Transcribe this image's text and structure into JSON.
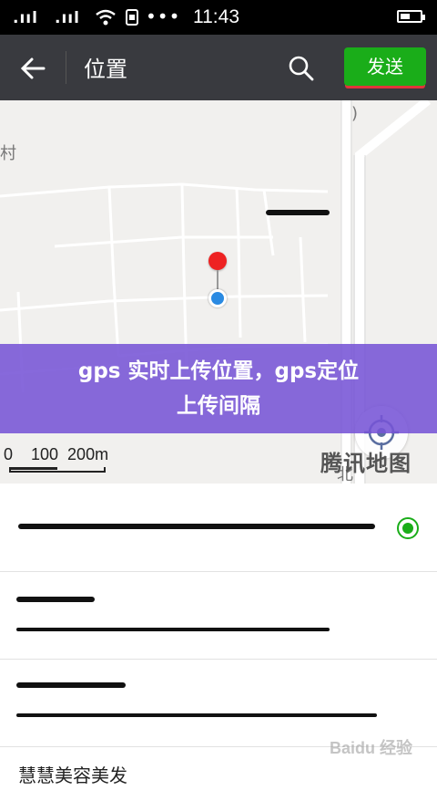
{
  "status_bar": {
    "signal_1": ".ııl",
    "signal_2": ".ııl",
    "time": "11:43"
  },
  "header": {
    "title": "位置",
    "send_label": "发送",
    "colors": {
      "bar": "#393a3f",
      "send": "#1aad19"
    }
  },
  "map": {
    "scale_label": "0    100  200m",
    "logo": "腾讯地图",
    "labels": {
      "left_edge": "村",
      "right_road": "北",
      "right_top": ")"
    }
  },
  "banner": {
    "line1": "gps 实时上传位置，gps定位",
    "line2": "上传间隔"
  },
  "results": {
    "last_item_name": "慧慧美容美发"
  },
  "watermark": "Baidu 经验"
}
